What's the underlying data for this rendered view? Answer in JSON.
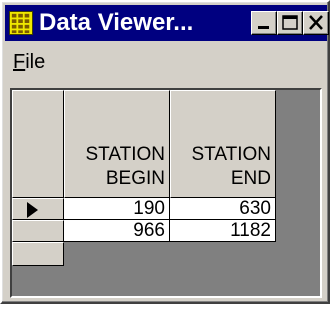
{
  "window": {
    "title": "Data Viewer...",
    "title_bar_color": "#000080",
    "face_color": "#d4d0c8"
  },
  "icons": {
    "app": "grid-app-icon",
    "minimize": "minimize-icon",
    "maximize": "maximize-icon",
    "close": "close-icon",
    "current_row": "current-row-arrow-icon"
  },
  "menu": {
    "file_mnemonic": "F",
    "file_rest": "ile"
  },
  "grid": {
    "columns": [
      {
        "line1": "STATION",
        "line2": "BEGIN"
      },
      {
        "line1": "STATION",
        "line2": "END"
      }
    ],
    "rows": [
      {
        "begin": "190",
        "end": "630",
        "current": true
      },
      {
        "begin": "966",
        "end": "1182",
        "current": false
      }
    ]
  }
}
